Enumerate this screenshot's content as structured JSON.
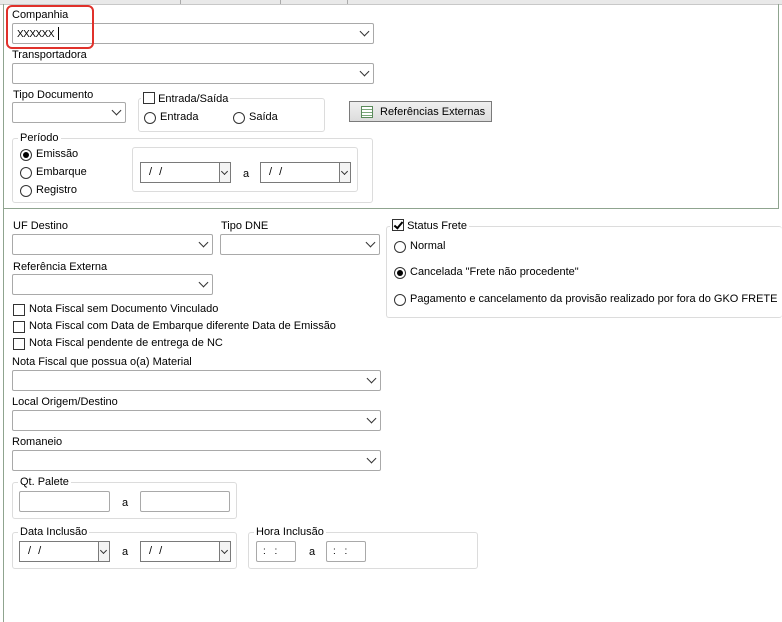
{
  "top_strip": {},
  "companhia": {
    "label": "Companhia",
    "value": "XXXXXX"
  },
  "transportadora": {
    "label": "Transportadora",
    "value": ""
  },
  "tipo_documento": {
    "label": "Tipo Documento",
    "value": ""
  },
  "entrada_saida": {
    "label": "Entrada/Saída",
    "checked": false,
    "options": [
      {
        "label": "Entrada",
        "selected": false
      },
      {
        "label": "Saída",
        "selected": false
      }
    ]
  },
  "referencias_externas_button": {
    "label": "Referências Externas",
    "icon": "spreadsheet-icon"
  },
  "periodo": {
    "label": "Período",
    "options": [
      {
        "label": "Emissão",
        "selected": true
      },
      {
        "label": "Embarque",
        "selected": false
      },
      {
        "label": "Registro",
        "selected": false
      }
    ],
    "from": "/ /",
    "sep": "a",
    "to": "/ /"
  },
  "uf_destino": {
    "label": "UF Destino",
    "value": ""
  },
  "tipo_dne": {
    "label": "Tipo DNE",
    "value": ""
  },
  "referencia_externa": {
    "label": "Referência Externa",
    "value": ""
  },
  "checkboxes": [
    {
      "label": "Nota Fiscal sem Documento Vinculado",
      "checked": false
    },
    {
      "label": "Nota Fiscal com Data de Embarque diferente Data de Emissão",
      "checked": false
    },
    {
      "label": "Nota Fiscal pendente de entrega de NC",
      "checked": false
    }
  ],
  "material": {
    "label": "Nota Fiscal que possua o(a) Material",
    "value": ""
  },
  "local": {
    "label": "Local Origem/Destino",
    "value": ""
  },
  "romaneio": {
    "label": "Romaneio",
    "value": ""
  },
  "qt_palete": {
    "label": "Qt. Palete",
    "sep": "a",
    "from": "",
    "to": ""
  },
  "data_inclusao": {
    "label": "Data Inclusão",
    "from": "/ /",
    "sep": "a",
    "to": "/ /"
  },
  "hora_inclusao": {
    "label": "Hora Inclusão",
    "from": ": :",
    "sep": "a",
    "to": ": :"
  },
  "status_frete": {
    "label": "Status Frete",
    "checked": true,
    "options": [
      {
        "label": "Normal",
        "selected": false
      },
      {
        "label": "Cancelada \"Frete não procedente\"",
        "selected": true
      },
      {
        "label": "Pagamento e cancelamento da provisão realizado por fora do GKO FRETE",
        "selected": false
      }
    ]
  },
  "colors": {
    "panel_border": "#8fa48f",
    "highlight": "#e0312b",
    "accent_green": "#5a8a5a"
  }
}
